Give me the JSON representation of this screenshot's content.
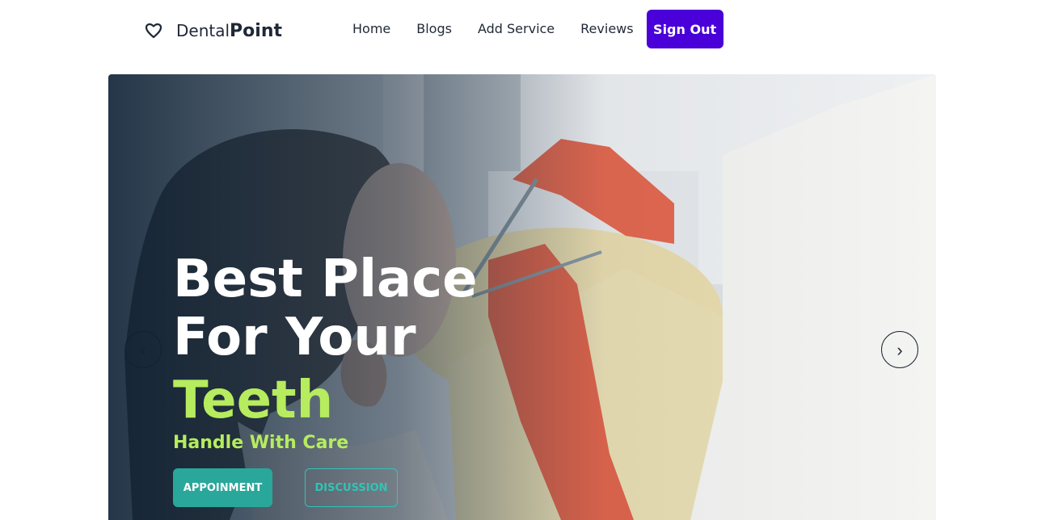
{
  "brand": {
    "prefix": "Dental",
    "bold": "Point",
    "logo_icon": "tooth-heart-icon"
  },
  "nav": {
    "home": "Home",
    "blogs": "Blogs",
    "add_service": "Add Service",
    "reviews": "Reviews",
    "sign_out": "Sign Out"
  },
  "hero": {
    "line1": "Best Place",
    "line2": "For Your",
    "line3": "Teeth",
    "tagline": "Handle With Care",
    "appointment_label": "APPOINMENT",
    "discussion_label": "DISCUSSION",
    "prev_label": "‹",
    "next_label": "›"
  },
  "colors": {
    "accent": "#4a00d8",
    "highlight": "#b6ec5e",
    "teal": "#2aa79b"
  }
}
